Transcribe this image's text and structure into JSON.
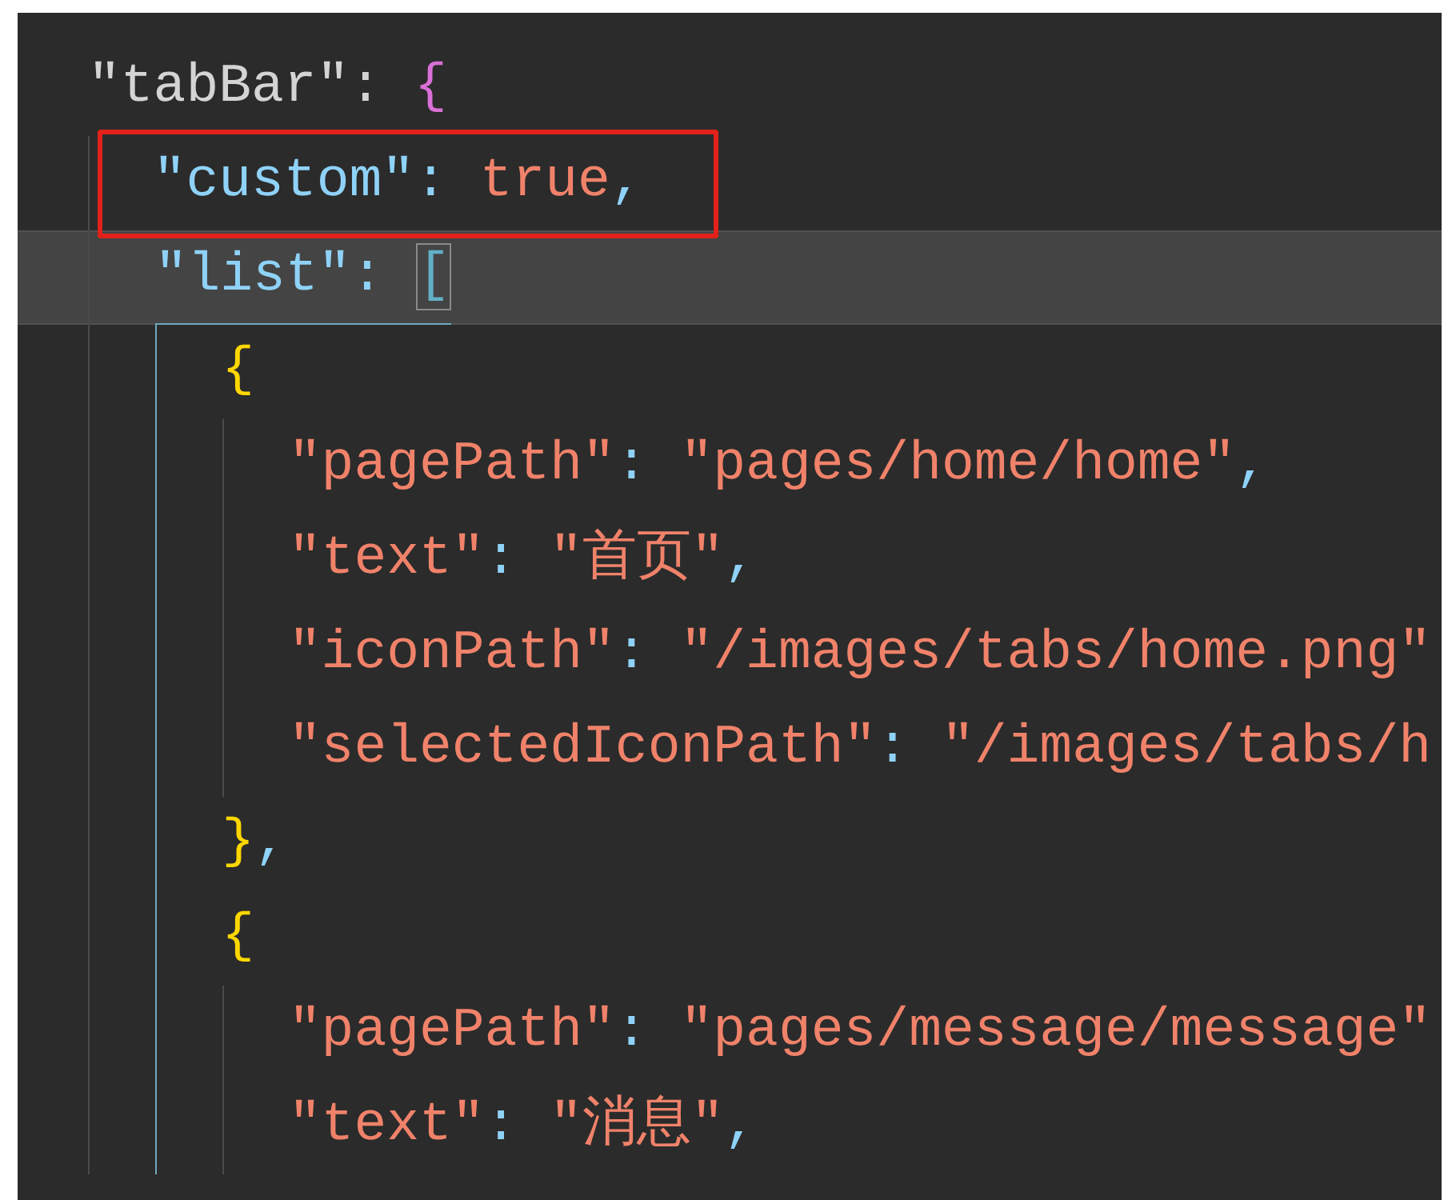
{
  "editor": {
    "lines": [
      {
        "current": false,
        "marked": false,
        "bracket_guide": false,
        "tokens": [
          {
            "kind": "plain",
            "text": "\"tabBar\""
          },
          {
            "kind": "plain",
            "text": ": "
          },
          {
            "kind": "brace1",
            "text": "{"
          }
        ],
        "children": [
          {
            "current": false,
            "marked": true,
            "bracket_guide": false,
            "tokens": [
              {
                "kind": "property",
                "text": "\"custom\""
              },
              {
                "kind": "punct",
                "text": ": "
              },
              {
                "kind": "literal",
                "text": "true"
              },
              {
                "kind": "punct",
                "text": ","
              }
            ]
          },
          {
            "current": true,
            "marked": false,
            "bracket_guide": true,
            "tokens": [
              {
                "kind": "property",
                "text": "\"list\""
              },
              {
                "kind": "punct",
                "text": ": "
              },
              {
                "kind": "matched",
                "text": "["
              }
            ],
            "children": [
              {
                "current": false,
                "marked": false,
                "bracket_guide": false,
                "tokens": [
                  {
                    "kind": "brace2",
                    "text": "{"
                  }
                ],
                "children": [
                  {
                    "current": false,
                    "marked": false,
                    "bracket_guide": false,
                    "tokens": [
                      {
                        "kind": "literal",
                        "text": "\"pagePath\""
                      },
                      {
                        "kind": "punct",
                        "text": ": "
                      },
                      {
                        "kind": "literal",
                        "text": "\"pages/home/home\""
                      },
                      {
                        "kind": "punct",
                        "text": ","
                      }
                    ]
                  },
                  {
                    "current": false,
                    "marked": false,
                    "bracket_guide": false,
                    "tokens": [
                      {
                        "kind": "literal",
                        "text": "\"text\""
                      },
                      {
                        "kind": "punct",
                        "text": ": "
                      },
                      {
                        "kind": "literal",
                        "text": "\"首页\""
                      },
                      {
                        "kind": "punct",
                        "text": ","
                      }
                    ]
                  },
                  {
                    "current": false,
                    "marked": false,
                    "bracket_guide": false,
                    "tokens": [
                      {
                        "kind": "literal",
                        "text": "\"iconPath\""
                      },
                      {
                        "kind": "punct",
                        "text": ": "
                      },
                      {
                        "kind": "literal",
                        "text": "\"/images/tabs/home.png\""
                      }
                    ]
                  },
                  {
                    "current": false,
                    "marked": false,
                    "bracket_guide": false,
                    "tokens": [
                      {
                        "kind": "literal",
                        "text": "\"selectedIconPath\""
                      },
                      {
                        "kind": "punct",
                        "text": ": "
                      },
                      {
                        "kind": "literal",
                        "text": "\"/images/tabs/h"
                      }
                    ]
                  }
                ]
              },
              {
                "current": false,
                "marked": false,
                "bracket_guide": false,
                "tokens": [
                  {
                    "kind": "brace2",
                    "text": "}"
                  },
                  {
                    "kind": "punct",
                    "text": ","
                  }
                ]
              },
              {
                "current": false,
                "marked": false,
                "bracket_guide": false,
                "tokens": [
                  {
                    "kind": "brace2",
                    "text": "{"
                  }
                ],
                "children": [
                  {
                    "current": false,
                    "marked": false,
                    "bracket_guide": false,
                    "tokens": [
                      {
                        "kind": "literal",
                        "text": "\"pagePath\""
                      },
                      {
                        "kind": "punct",
                        "text": ": "
                      },
                      {
                        "kind": "literal",
                        "text": "\"pages/message/message\""
                      }
                    ]
                  },
                  {
                    "current": false,
                    "marked": false,
                    "bracket_guide": false,
                    "tokens": [
                      {
                        "kind": "literal",
                        "text": "\"text\""
                      },
                      {
                        "kind": "punct",
                        "text": ": "
                      },
                      {
                        "kind": "literal",
                        "text": "\"消息\""
                      },
                      {
                        "kind": "punct",
                        "text": ","
                      }
                    ]
                  }
                ]
              }
            ]
          }
        ]
      }
    ]
  }
}
